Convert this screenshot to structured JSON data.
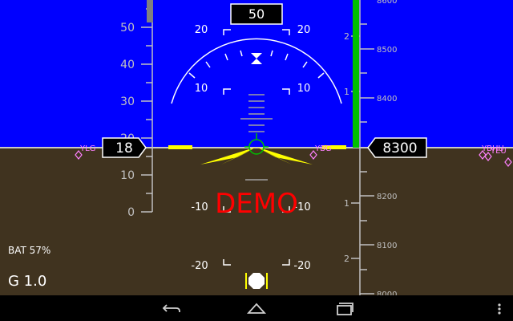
{
  "colors": {
    "sky": "#0000ff",
    "ground": "#40331f",
    "horizon": "#c9c9c9",
    "scale_lines": "#c0c0c0",
    "vs_bar": "#00c000",
    "aircraft": "#ffff00",
    "waypoint": "#ff80ff",
    "demo": "#ff0000",
    "nav_bar": "#000000"
  },
  "heading_box": "50",
  "speed_box": "18",
  "altitude_box": "8300",
  "demo_label": "DEMO",
  "battery": "BAT 57%",
  "g_meter": "G 1.0",
  "airspeed_ticks": [
    "50",
    "40",
    "30",
    "20",
    "10",
    "0"
  ],
  "altitude_ticks": [
    "8600",
    "8500",
    "8400",
    "8200",
    "8100",
    "8000"
  ],
  "vsi_ticks": [
    "2",
    "1",
    "1",
    "2"
  ],
  "pitch_marks": {
    "up20_left": "20",
    "up20_right": "20",
    "up10_left": "10",
    "up10_right": "10",
    "down10_left": "-10",
    "down10_right": "-10",
    "down20_left": "-20",
    "down20_right": "-20"
  },
  "waypoints": [
    "YLG",
    "YBG",
    "YBHU",
    "YEU"
  ],
  "nav_icons": [
    "back-icon",
    "home-icon",
    "recent-apps-icon",
    "menu-overflow-icon"
  ]
}
